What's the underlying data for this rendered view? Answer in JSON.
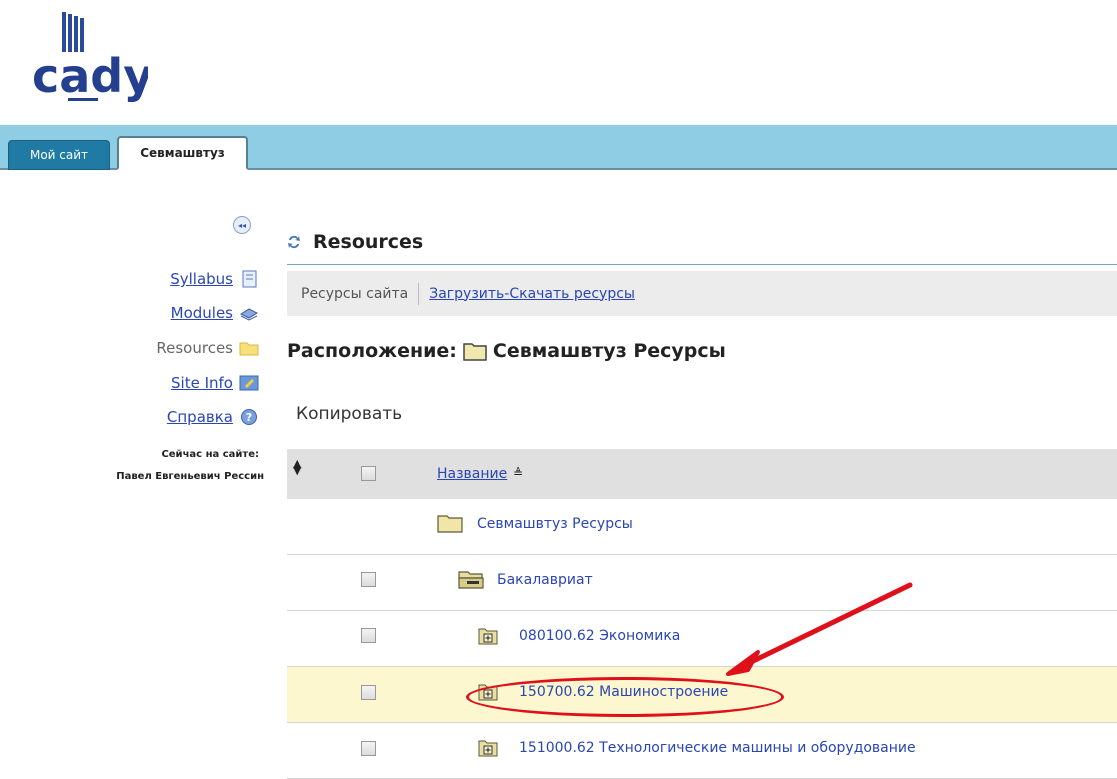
{
  "logo": {
    "text": "cady"
  },
  "tabs": [
    {
      "label": "Мой сайт",
      "active": false
    },
    {
      "label": "Севмашвтуз",
      "active": true
    }
  ],
  "sidebar": {
    "items": [
      {
        "label": "Syllabus",
        "icon": "syllabus-icon",
        "current": false
      },
      {
        "label": "Modules",
        "icon": "modules-icon",
        "current": false
      },
      {
        "label": "Resources",
        "icon": "folder-icon",
        "current": true
      },
      {
        "label": "Site Info",
        "icon": "site-info-icon",
        "current": false
      },
      {
        "label": "Справка",
        "icon": "help-icon",
        "current": false
      }
    ],
    "online_label": "Сейчас на сайте:",
    "online_user": "Павел Евгеньевич Рессин"
  },
  "main": {
    "title": "Resources",
    "toolbar": {
      "site_resources": "Ресурсы сайта",
      "upload_download": "Загрузить-Скачать ресурсы"
    },
    "location_label": "Расположение:",
    "location_value": "Севмашвтуз Ресурсы",
    "copy_label": "Копировать",
    "table": {
      "name_header": "Название",
      "rows": [
        {
          "label": "Севмашвтуз Ресурсы",
          "type": "folder-root"
        },
        {
          "label": "Бакалавриат",
          "type": "folder-open"
        },
        {
          "label": "080100.62 Экономика",
          "type": "folder-plus"
        },
        {
          "label": "150700.62 Машиностроение",
          "type": "folder-plus",
          "highlighted": true
        },
        {
          "label": "151000.62 Технологические машины и оборудование",
          "type": "folder-plus"
        }
      ]
    }
  },
  "colors": {
    "tabbar": "#8fcde4",
    "active_tab_border": "#5a7f8e",
    "link": "#2a46b5",
    "highlight": "#fcf7cf",
    "annotation": "#e0101a"
  }
}
